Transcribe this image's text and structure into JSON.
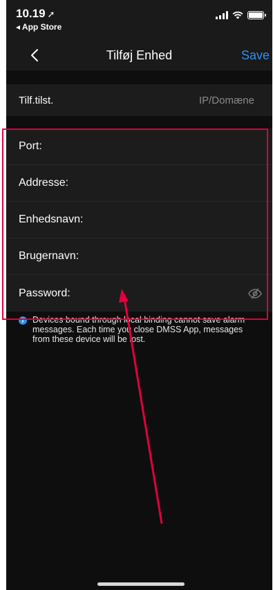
{
  "status_bar": {
    "time": "10.19",
    "back_app_label": "◂ App Store"
  },
  "nav": {
    "title": "Tilføj Enhed",
    "save_label": "Save"
  },
  "device_type": {
    "label": "Tilf.tilst.",
    "value": "IP/Domæne"
  },
  "form": {
    "fields": [
      {
        "label": "Port:",
        "value": ""
      },
      {
        "label": "Addresse:",
        "value": ""
      },
      {
        "label": "Enhedsnavn:",
        "value": ""
      },
      {
        "label": "Brugernavn:",
        "value": ""
      },
      {
        "label": "Password:",
        "value": ""
      }
    ]
  },
  "info": {
    "icon": "info-icon",
    "text": "Devices bound through local binding cannot save alarm messages. Each time you close DMSS App, messages from these device will be lost."
  },
  "colors": {
    "background": "#0e0e0e",
    "row_background": "#1c1c1c",
    "accent": "#2f8ff0",
    "annotation": "#e0003a"
  }
}
